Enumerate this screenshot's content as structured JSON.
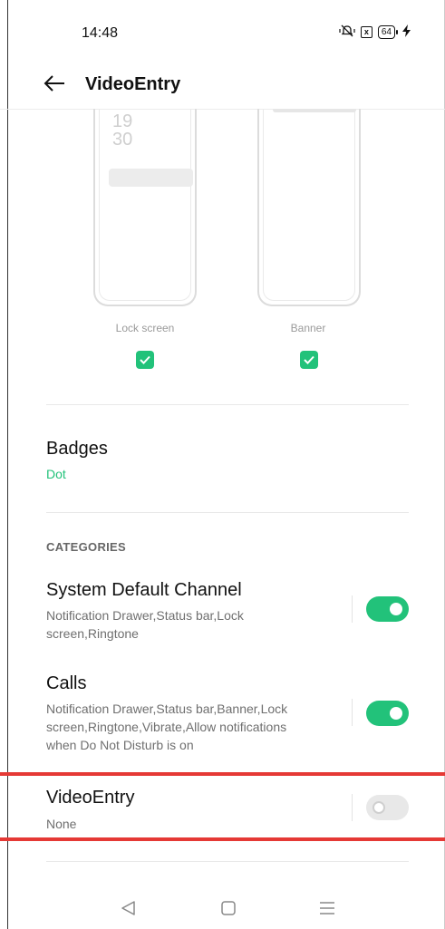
{
  "status_bar": {
    "time": "14:48",
    "mute_icon": "mute-vibrate-icon",
    "close_box_icon": "x",
    "battery": "64",
    "charging_icon": "bolt-icon"
  },
  "header": {
    "title": "VideoEntry",
    "back_icon": "arrow-left-icon"
  },
  "preview": {
    "lock_clock_hours": "19",
    "lock_clock_minutes": "30",
    "lock_label": "Lock screen",
    "banner_label": "Banner",
    "lock_checked": true,
    "banner_checked": true
  },
  "badges": {
    "title": "Badges",
    "value": "Dot"
  },
  "categories": {
    "header": "CATEGORIES",
    "items": [
      {
        "title": "System Default Channel",
        "subtitle": "Notification Drawer,Status bar,Lock screen,Ringtone",
        "enabled": true
      },
      {
        "title": "Calls",
        "subtitle": "Notification Drawer,Status bar,Banner,Lock screen,Ringtone,Vibrate,Allow notifications when Do Not Disturb is on",
        "enabled": true
      },
      {
        "title": "VideoEntry",
        "subtitle": "None",
        "enabled": false
      }
    ]
  },
  "colors": {
    "accent": "#22c27a",
    "highlight": "#e53935"
  },
  "navbar": {
    "back_icon": "triangle-back-icon",
    "home_icon": "square-home-icon",
    "menu_icon": "menu-lines-icon"
  }
}
